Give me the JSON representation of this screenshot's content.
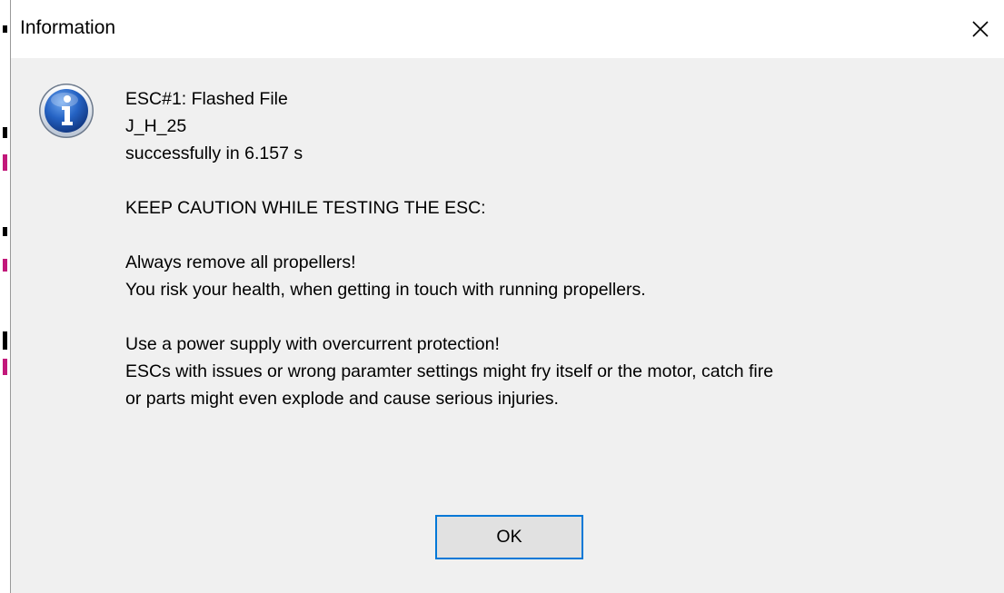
{
  "window": {
    "title": "Information",
    "close_glyph": "✕"
  },
  "icon": {
    "name": "information-icon",
    "glyph": "i",
    "color": "#1f5fb8"
  },
  "message": {
    "lines": [
      "ESC#1: Flashed File",
      "J_H_25",
      "successfully in 6.157 s",
      "",
      "KEEP CAUTION WHILE TESTING THE ESC:",
      "",
      "Always remove all propellers!",
      "You risk your health, when getting in touch with running propellers.",
      "",
      "Use a power supply with overcurrent protection!",
      "ESCs with issues or wrong paramter settings might fry itself or the motor, catch fire",
      "or parts might even explode and cause serious injuries."
    ]
  },
  "buttons": {
    "ok_label": "OK",
    "accent_color": "#0078d7"
  }
}
